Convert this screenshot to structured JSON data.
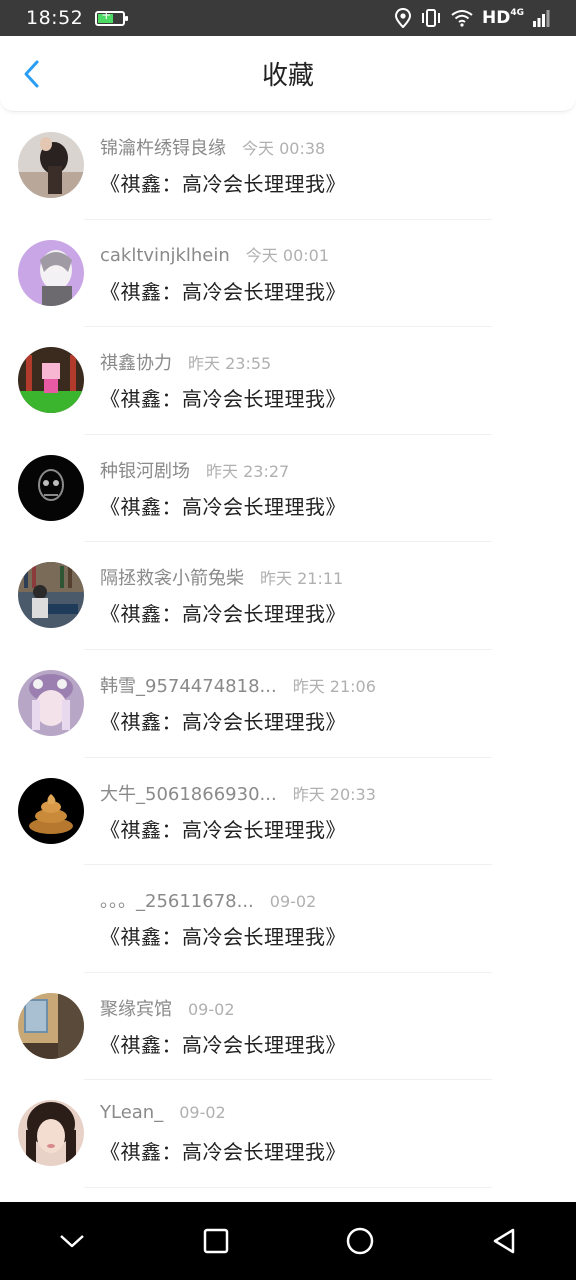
{
  "status_bar": {
    "time": "18:52",
    "network": "HD",
    "network_gen": "4G",
    "icons": [
      "battery-charging-icon",
      "location-icon",
      "vibrate-icon",
      "wifi-icon",
      "signal-icon"
    ]
  },
  "header": {
    "title": "收藏",
    "back_icon": "chevron-left-icon",
    "accent_color": "#2a9df4"
  },
  "items": [
    {
      "user": "锦瀹杵绣锝良缘",
      "time": "今天 00:38",
      "title": "《祺鑫：高冷会长理理我》",
      "avatar": "avatar-photo-woman"
    },
    {
      "user": "cakltvinjklhein",
      "time": "今天 00:01",
      "title": "《祺鑫：高冷会长理理我》",
      "avatar": "avatar-anime-purple"
    },
    {
      "user": "祺鑫协力",
      "time": "昨天 23:55",
      "title": "《祺鑫：高冷会长理理我》",
      "avatar": "avatar-pixel-character"
    },
    {
      "user": "种银河剧场",
      "time": "昨天 23:27",
      "title": "《祺鑫：高冷会长理理我》",
      "avatar": "avatar-dark-skull"
    },
    {
      "user": "隔拯救衾小箭兔柴",
      "time": "昨天 21:11",
      "title": "《祺鑫：高冷会长理理我》",
      "avatar": "avatar-library-photo"
    },
    {
      "user": "韩雪_9574474818...",
      "time": "昨天 21:06",
      "title": "《祺鑫：高冷会长理理我》",
      "avatar": "avatar-anime-girl"
    },
    {
      "user": "大牛_5061866930...",
      "time": "昨天 20:33",
      "title": "《祺鑫：高冷会长理理我》",
      "avatar": "avatar-poop-emoji"
    },
    {
      "user": "。。。_25611678...",
      "time": "09-02",
      "title": "《祺鑫：高冷会长理理我》",
      "avatar": "avatar-blank"
    },
    {
      "user": "聚缘宾馆",
      "time": "09-02",
      "title": "《祺鑫：高冷会长理理我》",
      "avatar": "avatar-room-photo"
    },
    {
      "user": "YLean_",
      "time": "09-02",
      "title": "《祺鑫：高冷会长理理我》",
      "avatar": "avatar-girl-selfie"
    }
  ],
  "nav_bar": {
    "icons": [
      "nav-down-icon",
      "nav-recent-icon",
      "nav-home-icon",
      "nav-back-icon"
    ]
  }
}
